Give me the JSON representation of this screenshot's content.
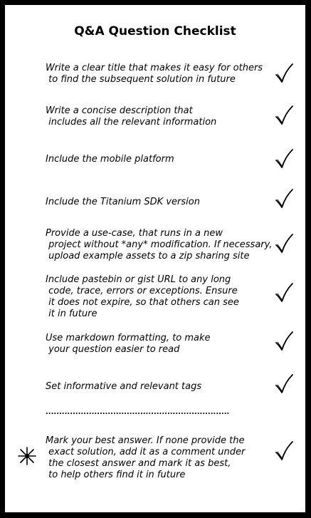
{
  "title": "Q&A Question Checklist",
  "items": [
    {
      "text": "Write a clear title that makes it easy for others\n to find the subsequent solution in future",
      "check_icon": "checkmark-icon"
    },
    {
      "text": "Write a concise description that\n includes all the relevant information",
      "check_icon": "checkmark-icon"
    },
    {
      "text": "Include the mobile platform",
      "check_icon": "checkmark-icon"
    },
    {
      "text": "Include the Titanium SDK version",
      "check_icon": "checkmark-icon"
    },
    {
      "text": "Provide a use-case, that runs in a new\n project without *any* modification. If necessary,\n upload example assets to a zip sharing site",
      "check_icon": "checkmark-icon"
    },
    {
      "text": "Include pastebin or gist URL to any long\n code, trace, errors or exceptions. Ensure\n it does not expire, so that others can see\n it in future",
      "check_icon": "checkmark-icon"
    },
    {
      "text": "Use markdown formatting, to make\n your question easier to read",
      "check_icon": "checkmark-icon"
    },
    {
      "text": "Set informative and relevant tags",
      "check_icon": "checkmark-icon"
    }
  ],
  "separator": "....................................................................",
  "final_item": {
    "text": "Mark your best answer. If none provide the\n exact solution, add it as a comment under\n the closest answer and mark it as best,\n to help others find it in future",
    "marker_icon": "asterisk-star-icon",
    "check_icon": "checkmark-icon"
  },
  "colors": {
    "frame": "#000000",
    "card": "#ffffff",
    "text": "#000000"
  }
}
